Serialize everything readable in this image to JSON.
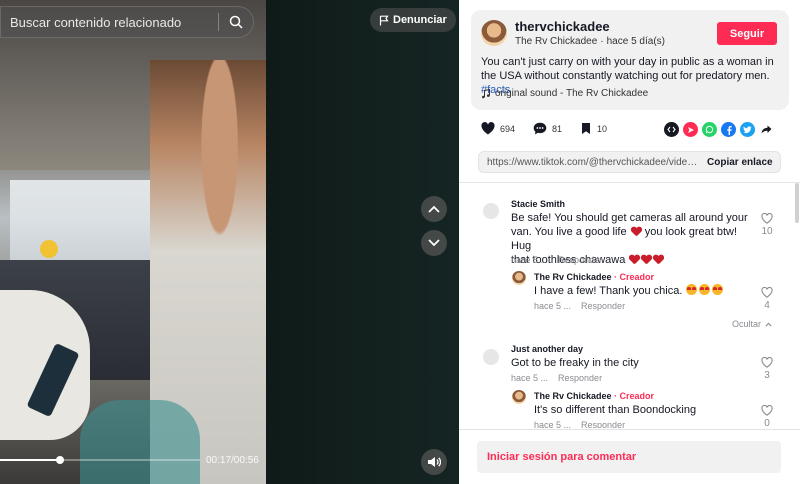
{
  "search": {
    "placeholder": "Buscar contenido relacionado"
  },
  "video": {
    "report_label": "Denunciar",
    "time": "00:17/00:56",
    "progress": 0.3
  },
  "author": {
    "handle": "thervchickadee",
    "display_name": "The Rv Chickadee",
    "separator": "·",
    "posted": "hace 5 día(s)",
    "follow_label": "Seguir"
  },
  "post": {
    "caption": "You can't just carry on with your day in public as a woman in the USA without constantly watching out for predatory men. ",
    "hashtag": "#facts",
    "sound": "original sound - The Rv Chickadee"
  },
  "actions": {
    "likes": "694",
    "comments": "81",
    "saves": "10"
  },
  "share": {
    "url": "https://www.tiktok.com/@thervchickadee/video/7...",
    "copy_label": "Copiar enlace"
  },
  "comments": [
    {
      "author": "Stacie Smith",
      "text_line1": "Be safe! You should get cameras all around your",
      "text_line2": "van. You live a good life",
      "text_line2b": "you look great btw! Hug",
      "text_line3": "that toothless chawawa",
      "time": "hace 5 ...",
      "reply_label": "Responder",
      "likes": "10",
      "reply": {
        "author": "The Rv Chickadee",
        "badge": "· Creador",
        "text": "I have a few! Thank you chica.",
        "time": "hace 5 ...",
        "reply_label": "Responder",
        "likes": "4"
      },
      "hide_label": "Ocultar"
    },
    {
      "author": "Just another day",
      "text_line1": "Got to be freaky in the city",
      "time": "hace 5 ...",
      "reply_label": "Responder",
      "likes": "3",
      "reply": {
        "author": "The Rv Chickadee",
        "badge": "· Creador",
        "text": "It's so different than Boondocking",
        "time": "hace 5 ...",
        "reply_label": "Responder",
        "likes": "0"
      }
    }
  ],
  "login": {
    "label": "Iniciar sesión para comentar"
  },
  "colors": {
    "accent": "#fe2c55",
    "hashtag": "#2b5db9"
  }
}
